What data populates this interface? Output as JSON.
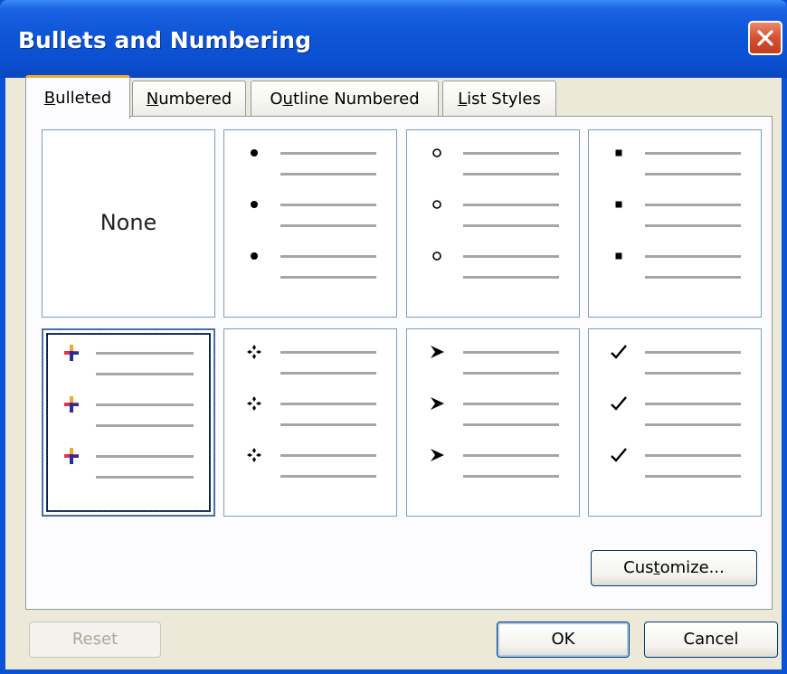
{
  "dialog": {
    "title": "Bullets and Numbering"
  },
  "tabs": [
    {
      "label_pre": "",
      "label_key": "B",
      "label_post": "ulleted",
      "active": true
    },
    {
      "label_pre": "",
      "label_key": "N",
      "label_post": "umbered",
      "active": false
    },
    {
      "label_pre": "O",
      "label_key": "u",
      "label_post": "tline Numbered",
      "active": false
    },
    {
      "label_pre": "",
      "label_key": "L",
      "label_post": "ist Styles",
      "active": false
    }
  ],
  "gallery": {
    "none_label": "None",
    "styles": [
      {
        "kind": "none"
      },
      {
        "kind": "filled-dot",
        "icon": "filled-dot-bullet-icon"
      },
      {
        "kind": "hollow-circle",
        "icon": "hollow-circle-bullet-icon"
      },
      {
        "kind": "filled-square",
        "icon": "filled-square-bullet-icon"
      },
      {
        "kind": "cross-picture",
        "icon": "colored-cross-bullet-icon",
        "selected": true
      },
      {
        "kind": "four-diamond",
        "icon": "four-diamond-bullet-icon"
      },
      {
        "kind": "arrowhead",
        "icon": "arrowhead-bullet-icon"
      },
      {
        "kind": "checkmark",
        "icon": "checkmark-bullet-icon"
      }
    ]
  },
  "buttons": {
    "customize_pre": "Cus",
    "customize_key": "t",
    "customize_post": "omize...",
    "reset": "Reset",
    "ok": "OK",
    "cancel": "Cancel"
  },
  "colors": {
    "titlebar": "#0a52d6",
    "dialog_face": "#ece9d8",
    "active_tab_accent": "#f4a832",
    "close_button": "#d5502e"
  }
}
